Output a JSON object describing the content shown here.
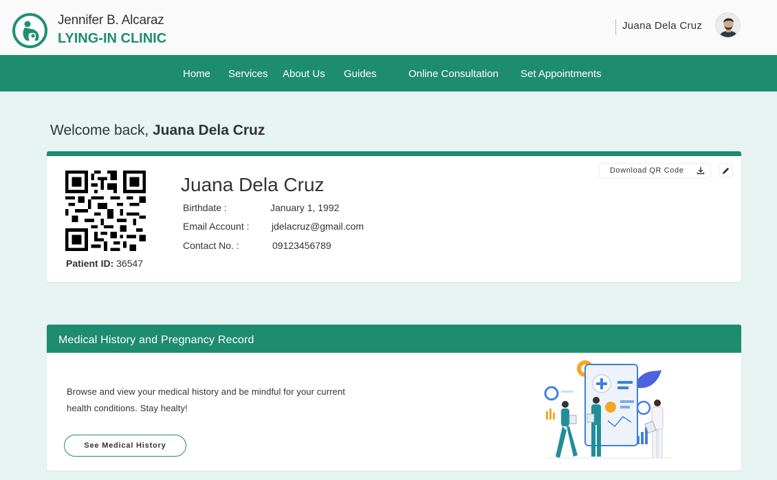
{
  "brand": {
    "name": "Jennifer B. Alcaraz",
    "clinic": "LYING-IN CLINIC"
  },
  "user": {
    "name": "Juana Dela Cruz"
  },
  "nav": {
    "items": [
      {
        "label": "Home"
      },
      {
        "label": "Services"
      },
      {
        "label": "About Us"
      },
      {
        "label": "Guides"
      },
      {
        "label": "Online Consultation"
      },
      {
        "label": "Set Appointments"
      }
    ]
  },
  "welcome": {
    "prefix": "Welcome back, ",
    "name": "Juana Dela Cruz"
  },
  "profile": {
    "name": "Juana Dela Cruz",
    "patient_id_label": "Patient ID:",
    "patient_id": "36547",
    "fields": [
      {
        "label": "Birthdate :",
        "value": "January 1, 1992"
      },
      {
        "label": "Email Account :",
        "value": "jdelacruz@gmail.com"
      },
      {
        "label": "Contact No. :",
        "value": "09123456789"
      }
    ],
    "download_label": "Download QR Code"
  },
  "medical": {
    "title": "Medical History and Pregnancy Record",
    "description": "Browse and view your medical history and be mindful for your current health conditions. Stay healty!",
    "button_label": "See Medical History"
  },
  "colors": {
    "primary": "#1e8c6e",
    "background": "#e8f4f2",
    "accent_orange": "#f5a623",
    "accent_blue": "#3d7fe0"
  },
  "icons": [
    "pregnant-woman-logo-icon",
    "user-avatar-icon",
    "qr-code-icon",
    "download-icon",
    "pencil-icon",
    "medical-team-illustration"
  ]
}
